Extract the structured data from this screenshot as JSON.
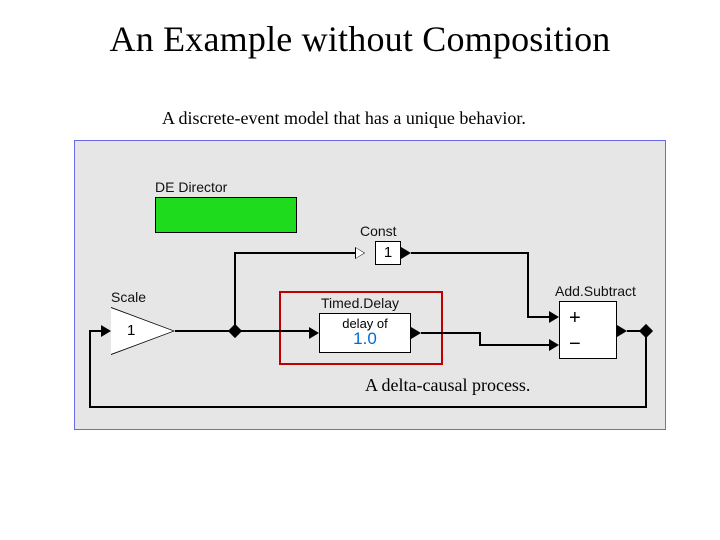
{
  "title": "An Example without Composition",
  "subtitle": "A discrete-event model that has a unique behavior.",
  "director": {
    "label": "DE Director"
  },
  "scale": {
    "label": "Scale",
    "value": "1"
  },
  "const": {
    "label": "Const",
    "value": "1"
  },
  "timed": {
    "label": "Timed.Delay",
    "line1": "delay of",
    "value": "1.0"
  },
  "add": {
    "label": "Add.Subtract",
    "plus": "+",
    "minus": "−"
  },
  "delta_caption": "A delta-causal process."
}
